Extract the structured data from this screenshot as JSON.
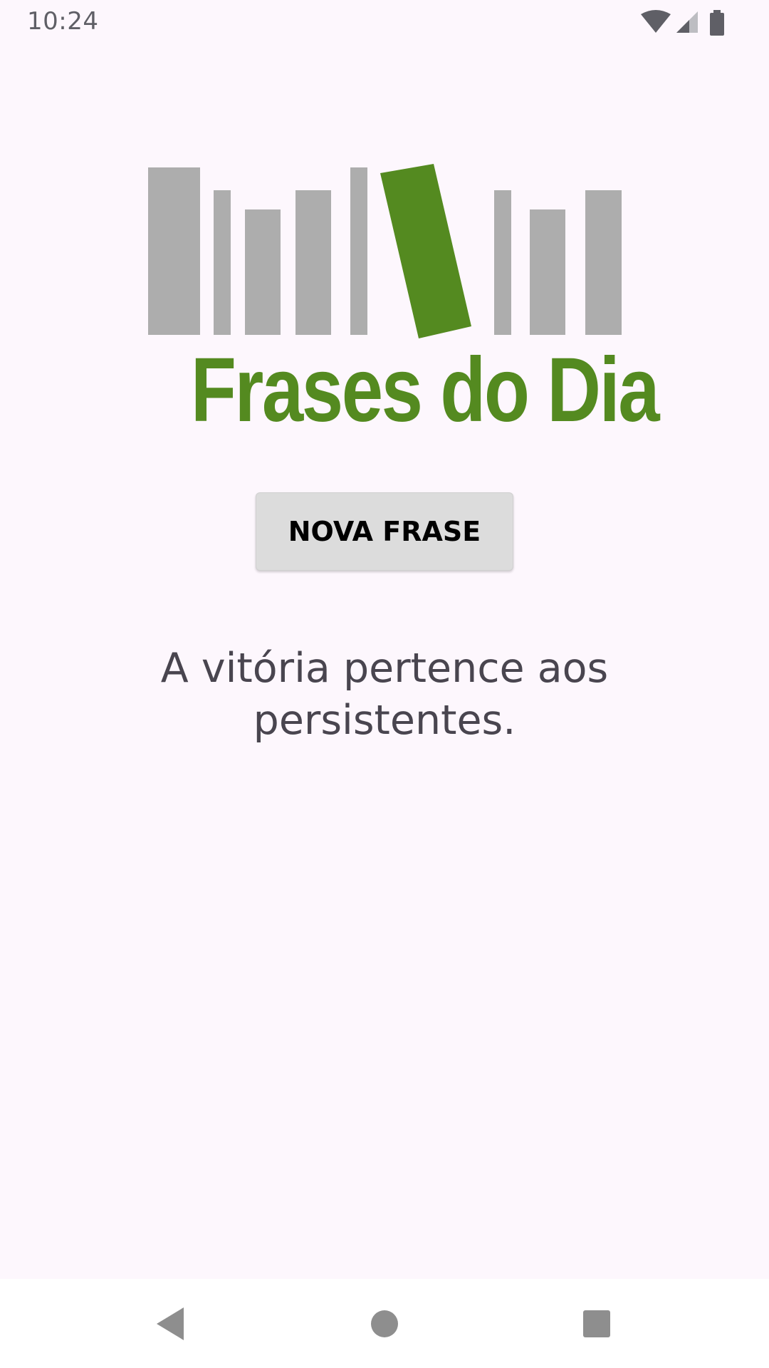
{
  "status_bar": {
    "time": "10:24",
    "icons": [
      "wifi-icon",
      "cellular-signal-icon",
      "battery-icon"
    ]
  },
  "logo": {
    "text": "Frases do Dia",
    "colors": {
      "bars": "#adadad",
      "accent": "#548a20"
    }
  },
  "main": {
    "button_label": "NOVA FRASE",
    "quote": "A vitória pertence aos persistentes."
  },
  "nav_bar": {
    "buttons": [
      "back-icon",
      "home-icon",
      "recents-icon"
    ]
  },
  "colors": {
    "background": "#fdf7fd",
    "button_background": "#dcdcdc",
    "quote_text": "#49454f",
    "status_text": "#5f5f66"
  }
}
